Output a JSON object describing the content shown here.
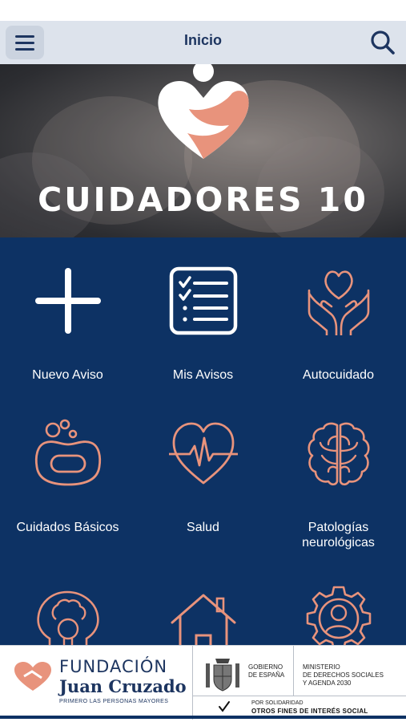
{
  "header": {
    "title": "Inicio",
    "menu_icon": "hamburger-menu-icon",
    "search_icon": "search-icon"
  },
  "hero": {
    "title": "CUIDADORES 10",
    "logo_icon": "heart-person-logo"
  },
  "tiles": [
    {
      "label": "Nuevo Aviso",
      "icon": "plus-icon"
    },
    {
      "label": "Mis Avisos",
      "icon": "checklist-icon"
    },
    {
      "label": "Autocuidado",
      "icon": "hands-heart-icon"
    },
    {
      "label": "Cuidados Básicos",
      "icon": "soap-bubbles-icon"
    },
    {
      "label": "Salud",
      "icon": "heartbeat-icon"
    },
    {
      "label": "Patologías",
      "label2": "neurológicas",
      "icon": "brain-icon"
    },
    {
      "label": "",
      "icon": "head-lightbulb-icon"
    },
    {
      "label": "",
      "icon": "house-icon"
    },
    {
      "label": "",
      "icon": "gear-person-icon"
    }
  ],
  "footer": {
    "foundation_line1": "FUNDACIÓN",
    "foundation_line2": "Juan Cruzado",
    "foundation_tagline": "PRIMERO LAS PERSONAS MAYORES",
    "gov_line1": "GOBIERNO",
    "gov_line2": "DE ESPAÑA",
    "ministry_line1": "MINISTERIO",
    "ministry_line2": "DE DERECHOS SOCIALES",
    "ministry_line3": "Y AGENDA 2030",
    "solidarity_line1": "POR SOLIDARIDAD",
    "solidarity_line2": "OTROS FINES DE INTERÉS SOCIAL"
  },
  "colors": {
    "navy": "#0d3264",
    "accent": "#e8937c",
    "topbar": "#dde3ec"
  }
}
